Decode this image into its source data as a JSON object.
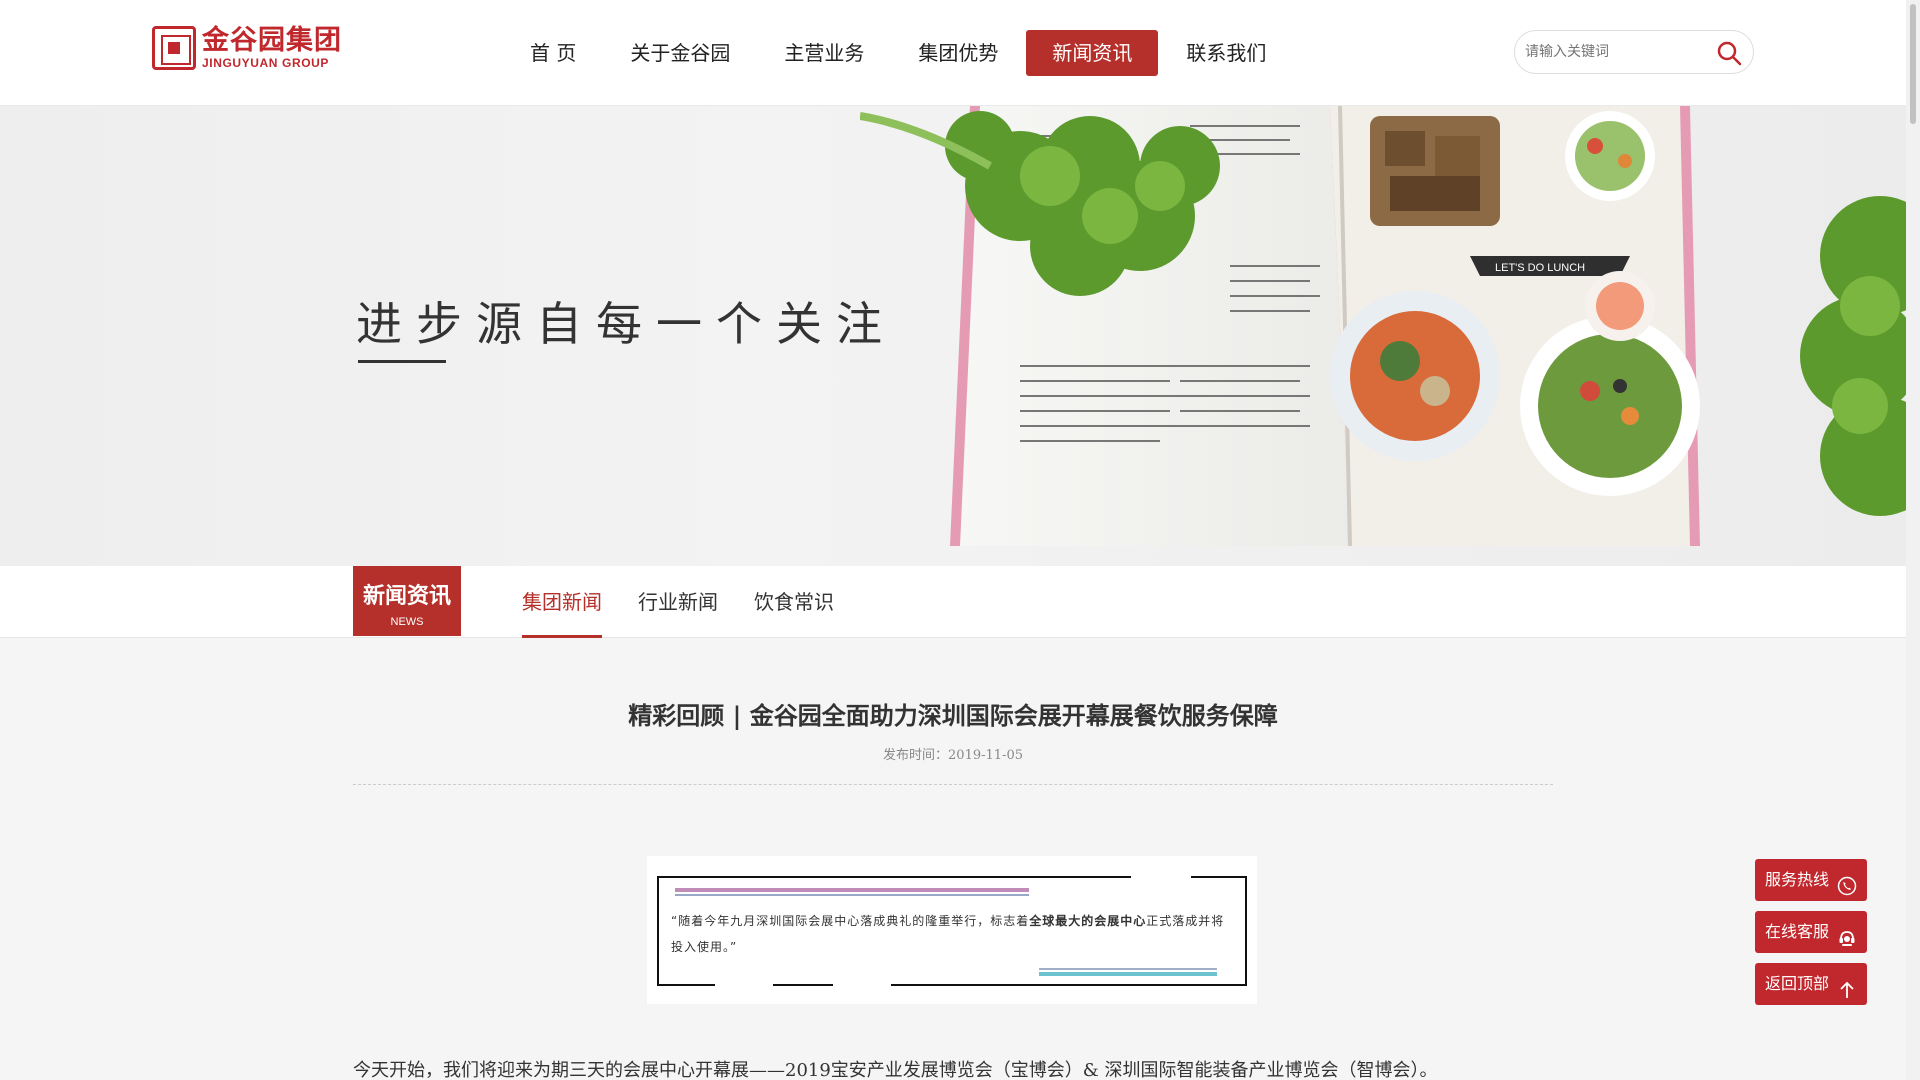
{
  "header": {
    "logo_cn": "金谷园集团",
    "logo_en": "JINGUYUAN GROUP",
    "nav": [
      {
        "label": "首 页",
        "active": false
      },
      {
        "label": "关于金谷园",
        "active": false
      },
      {
        "label": "主营业务",
        "active": false
      },
      {
        "label": "集团优势",
        "active": false
      },
      {
        "label": "新闻资讯",
        "active": true
      },
      {
        "label": "联系我们",
        "active": false
      }
    ],
    "search_placeholder": "请输入关键词"
  },
  "banner": {
    "slogan": "进步源自每一个关注",
    "book_label": "LET'S DO LUNCH"
  },
  "subnav": {
    "section_cn": "新闻资讯",
    "section_en": "NEWS",
    "tabs": [
      {
        "label": "集团新闻",
        "active": true
      },
      {
        "label": "行业新闻",
        "active": false
      },
      {
        "label": "饮食常识",
        "active": false
      }
    ]
  },
  "article": {
    "title": "精彩回顾 | 金谷园全面助力深圳国际会展开幕展餐饮服务保障",
    "date_label": "发布时间：",
    "date": "2019-11-05",
    "quote_part1": "“随着今年九月深圳国际会展中心落成典礼的隆重举行，标志着",
    "quote_bold": "全球最大的会展中心",
    "quote_part2": "正式落成并将投入使用。”",
    "paragraph": "今天开始，我们将迎来为期三天的会展中心开幕展——2019宝安产业发展博览会（宝博会）& 深圳国际智能装备产业博览会（智博会）。"
  },
  "side_buttons": {
    "hotline": "服务热线",
    "online": "在线客服",
    "top": "返回顶部"
  },
  "colors": {
    "brand_red": "#b5302a",
    "float_red": "#c0282d"
  },
  "icons": [
    "search-icon",
    "phone-icon",
    "headset-icon",
    "arrow-up-icon"
  ]
}
